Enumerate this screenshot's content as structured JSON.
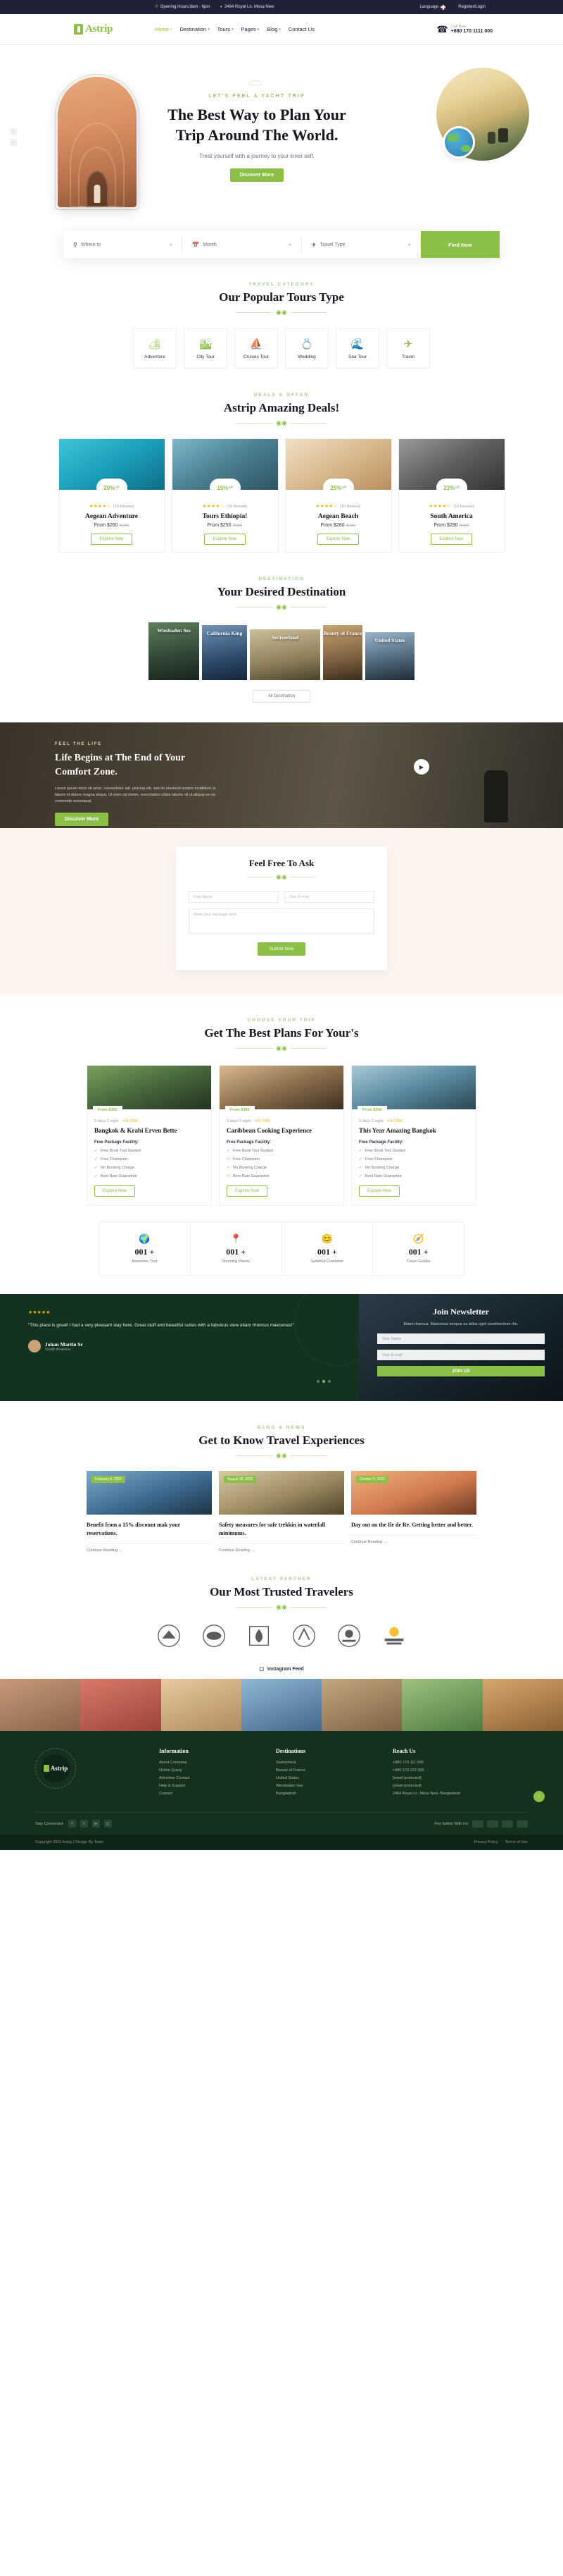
{
  "topbar": {
    "opening_label": "Opening Hours:8am - 6pm",
    "address": "2464 Royal Ln. Mesa New",
    "language": "Language",
    "register": "Register/Login",
    "clock_icon": "clock-icon",
    "pin_icon": "map-pin-icon",
    "flag_icon": "flag-icon"
  },
  "header": {
    "brand": "Astrip",
    "nav": [
      {
        "label": "Home",
        "caret": "⌄",
        "active": true
      },
      {
        "label": "Destination",
        "caret": "⌄",
        "active": false
      },
      {
        "label": "Tours",
        "caret": "⌄",
        "active": false
      },
      {
        "label": "Pages",
        "caret": "⌄",
        "active": false
      },
      {
        "label": "Blog",
        "caret": "⌄",
        "active": false
      },
      {
        "label": "Contact Us",
        "caret": "",
        "active": false
      }
    ],
    "call_label": "Call Now",
    "call_number": "+880 170 1111 000"
  },
  "hero": {
    "kicker": "LET'S FEEL A YACHT TRIP",
    "title_line1": "The Best Way to Plan Your",
    "title_line2": "Trip Around The World.",
    "subtitle": "Treat yourself with a journey to your inner self.",
    "cta": "Discover More",
    "nav_prev": "‹",
    "nav_next": "›"
  },
  "search": {
    "where_label": "Where to",
    "month_label": "Month",
    "type_label": "Travel Type",
    "button": "Find Now",
    "where_icon": "map-pin-icon",
    "month_icon": "calendar-icon",
    "type_icon": "travel-icon",
    "caret": "⌄"
  },
  "tour_types": {
    "kicker": "TRAVEL CATEGORY",
    "title": "Our Popular Tours Type",
    "items": [
      {
        "label": "Adventure",
        "icon": "🏕",
        "icon_name": "adventure-icon"
      },
      {
        "label": "City Tour",
        "icon": "🏙",
        "icon_name": "city-tour-icon"
      },
      {
        "label": "Cruises Tour",
        "icon": "⛵",
        "icon_name": "cruises-icon"
      },
      {
        "label": "Wedding",
        "icon": "💍",
        "icon_name": "wedding-icon"
      },
      {
        "label": "Sea Tour",
        "icon": "🌊",
        "icon_name": "sea-tour-icon"
      },
      {
        "label": "Travel",
        "icon": "✈",
        "icon_name": "travel-icon"
      }
    ]
  },
  "deals": {
    "kicker": "DEALS & OFFER",
    "title": "Astrip Amazing Deals!",
    "cards": [
      {
        "discount": "20%",
        "off": "off",
        "stars": "★★★★☆",
        "reviews": "(10 Review)",
        "name": "Aegean Adventure",
        "price": "From $260",
        "old_price": "/$480",
        "button": "Explore Now",
        "img": "d1"
      },
      {
        "discount": "15%",
        "off": "off",
        "stars": "★★★★☆",
        "reviews": "(10 Review)",
        "name": "Tours Ethiopia!",
        "price": "From $250",
        "old_price": "/$480",
        "button": "Explore Now",
        "img": "d2"
      },
      {
        "discount": "25%",
        "off": "off",
        "stars": "★★★★☆",
        "reviews": "(10 Review)",
        "name": "Aegean Beach",
        "price": "From $280",
        "old_price": "/$480",
        "button": "Explore Now",
        "img": "d3"
      },
      {
        "discount": "23%",
        "off": "off",
        "stars": "★★★★☆",
        "reviews": "(10 Review)",
        "name": "South America",
        "price": "From $290",
        "old_price": "/$480",
        "button": "Explore Now",
        "img": "d4"
      }
    ]
  },
  "destinations": {
    "kicker": "DESTINATION",
    "title": "Your Desired Destination",
    "items": [
      {
        "label": "Wiesbaden Ses",
        "cls": "d-a"
      },
      {
        "label": "California King",
        "cls": "d-b"
      },
      {
        "label": "Switzerland",
        "cls": "d-c"
      },
      {
        "label": "Beauty of France",
        "cls": "d-d"
      },
      {
        "label": "United States",
        "cls": "d-e"
      }
    ],
    "all_button": "All Destination"
  },
  "cta_banner": {
    "kicker": "FEEL THE LIFE",
    "title_line1": "Life Begins at The End of Your",
    "title_line2": "Comfort Zone.",
    "paragraph": "Lorem ipsum dolor sit amet, consectetur adi. pisicing elit, sed do eiusmod tempor incididunt ut labore et dolore magna aliqua. Ut enim ad minim, exercitation ullam laboris nil ut aliquip ex ea commodo consequat.",
    "button": "Discover More",
    "play_icon": "play-icon"
  },
  "ask": {
    "title": "Feel Free To Ask",
    "first_name_ph": "First Name",
    "email_ph": "Your E-mail",
    "message_ph": "Write your message here",
    "button": "Submit Now"
  },
  "plans": {
    "kicker": "CHOOSE YOUR TRIP",
    "title": "Get The Best Plans For Your's",
    "cards": [
      {
        "tag": "From $300",
        "days": "3 days 1 night",
        "rating": "4.8 (786)",
        "name": "Bangkok & Krabi Erven Bette",
        "features_title": "Free Package Facility:",
        "features": [
          "Free Book Tour Guided",
          "Free Champion",
          "No Booking Charge",
          "Best Rate Guarantee"
        ],
        "button": "Explore Now",
        "img": "p1"
      },
      {
        "tag": "From $300",
        "days": "3 days 1 night",
        "rating": "4.8 (786)",
        "name": "Caribbean Cooking Experience",
        "features_title": "Free Package Facility:",
        "features": [
          "Free Book Tour Guided",
          "Free Champion",
          "No Booking Charge",
          "Best Rate Guarantee"
        ],
        "button": "Explore Now",
        "img": "p2"
      },
      {
        "tag": "From $300",
        "days": "3 days 1 night",
        "rating": "4.8 (786)",
        "name": "This Year Amazing Bangkok",
        "features_title": "Free Package Facility:",
        "features": [
          "Free Book Tour Guided",
          "Free Champion",
          "No Booking Charge",
          "Best Rate Guarantee"
        ],
        "button": "Explore Now",
        "img": "p3"
      }
    ]
  },
  "counters": [
    {
      "value": "001 +",
      "label": "Awesome Tour",
      "icon": "🌍",
      "icon_name": "globe-icon"
    },
    {
      "value": "001 +",
      "label": "Stunning Places",
      "icon": "📍",
      "icon_name": "location-icon"
    },
    {
      "value": "001 +",
      "label": "Satisfied Customer",
      "icon": "😊",
      "icon_name": "smile-icon"
    },
    {
      "value": "001 +",
      "label": "Travel Guides",
      "icon": "🧭",
      "icon_name": "compass-icon"
    }
  ],
  "testimonial": {
    "stars": "★★★★★",
    "quote": "\"This place is great! I had a very pleasant stay here. Great stuff and beautiful suites with a fabulous view etiam rhoncus maecenas!\"",
    "name": "Johan Martin Sr",
    "role": "South America",
    "dots": 3,
    "active_dot": 1
  },
  "newsletter": {
    "title": "Join Newsletter",
    "paragraph": "Etiam rhoncus. Maecenas tempus ea tellus eget condimentum rho.",
    "name_ph": "Your Name",
    "email_ph": "Your E-mail",
    "button": "JOIN US"
  },
  "blog": {
    "kicker": "BLOG & NEWS",
    "title": "Get to Know Travel Experiences",
    "posts": [
      {
        "date": "February 8, 2022",
        "title": "Benefit from a 15% discount mak your reservations.",
        "read_more": "Continue Reading →",
        "img": "b1"
      },
      {
        "date": "August 08, 2022",
        "title": "Safety measures for safe trekkin in waterfall minimums.",
        "read_more": "Continue Reading →",
        "img": "b2"
      },
      {
        "date": "October 5, 2022",
        "title": "Day out on the Ile de Re. Getting better and better.",
        "read_more": "Continue Reading →",
        "img": "b3"
      }
    ]
  },
  "partners": {
    "kicker": "LATEST PARTNER",
    "title": "Our Most Trusted Travelers",
    "logos": [
      "partner-logo-1",
      "partner-logo-2",
      "partner-logo-3",
      "partner-logo-4",
      "partner-logo-5",
      "partner-logo-6"
    ]
  },
  "instagram": {
    "heading": "Instagram Feed",
    "icon": "instagram-icon"
  },
  "footer": {
    "brand": "Astrip",
    "badge_text": "TRAVEL AGENCY · ASTRIP ·",
    "columns": [
      {
        "title": "Information",
        "items": [
          "About Company",
          "Online Query",
          "Advertise Contact",
          "Help & Support",
          "Contact"
        ]
      },
      {
        "title": "Destinations",
        "items": [
          "Switzerland",
          "Beauty of France",
          "United States",
          "Wiesbaden Ses",
          "Bangladesh"
        ]
      }
    ],
    "reach_title": "Reach Us",
    "reach_items": [
      "+880 170 111 000",
      "+880 170 222 000",
      "[email protected]",
      "[email protected]",
      "2464 Royal Ln. Mesa New, Bangladesh"
    ],
    "social_label": "Stay Connected:",
    "social_icons": [
      "facebook-icon",
      "twitter-icon",
      "linkedin-icon",
      "instagram-icon"
    ],
    "pay_label": "Pay Safely With Us!",
    "pay_cards": [
      "visa-card",
      "mastercard-card",
      "paypal-card",
      "amex-card"
    ],
    "copyright": "Copyright 2022 Astrip | Design By Team",
    "links": [
      "Privacy Policy",
      "Terms of Use"
    ],
    "gotop_icon": "↑"
  },
  "colors": {
    "accent": "#8cbf45",
    "dark": "#1f2137",
    "footer": "#15311e",
    "star": "#f5b301"
  }
}
